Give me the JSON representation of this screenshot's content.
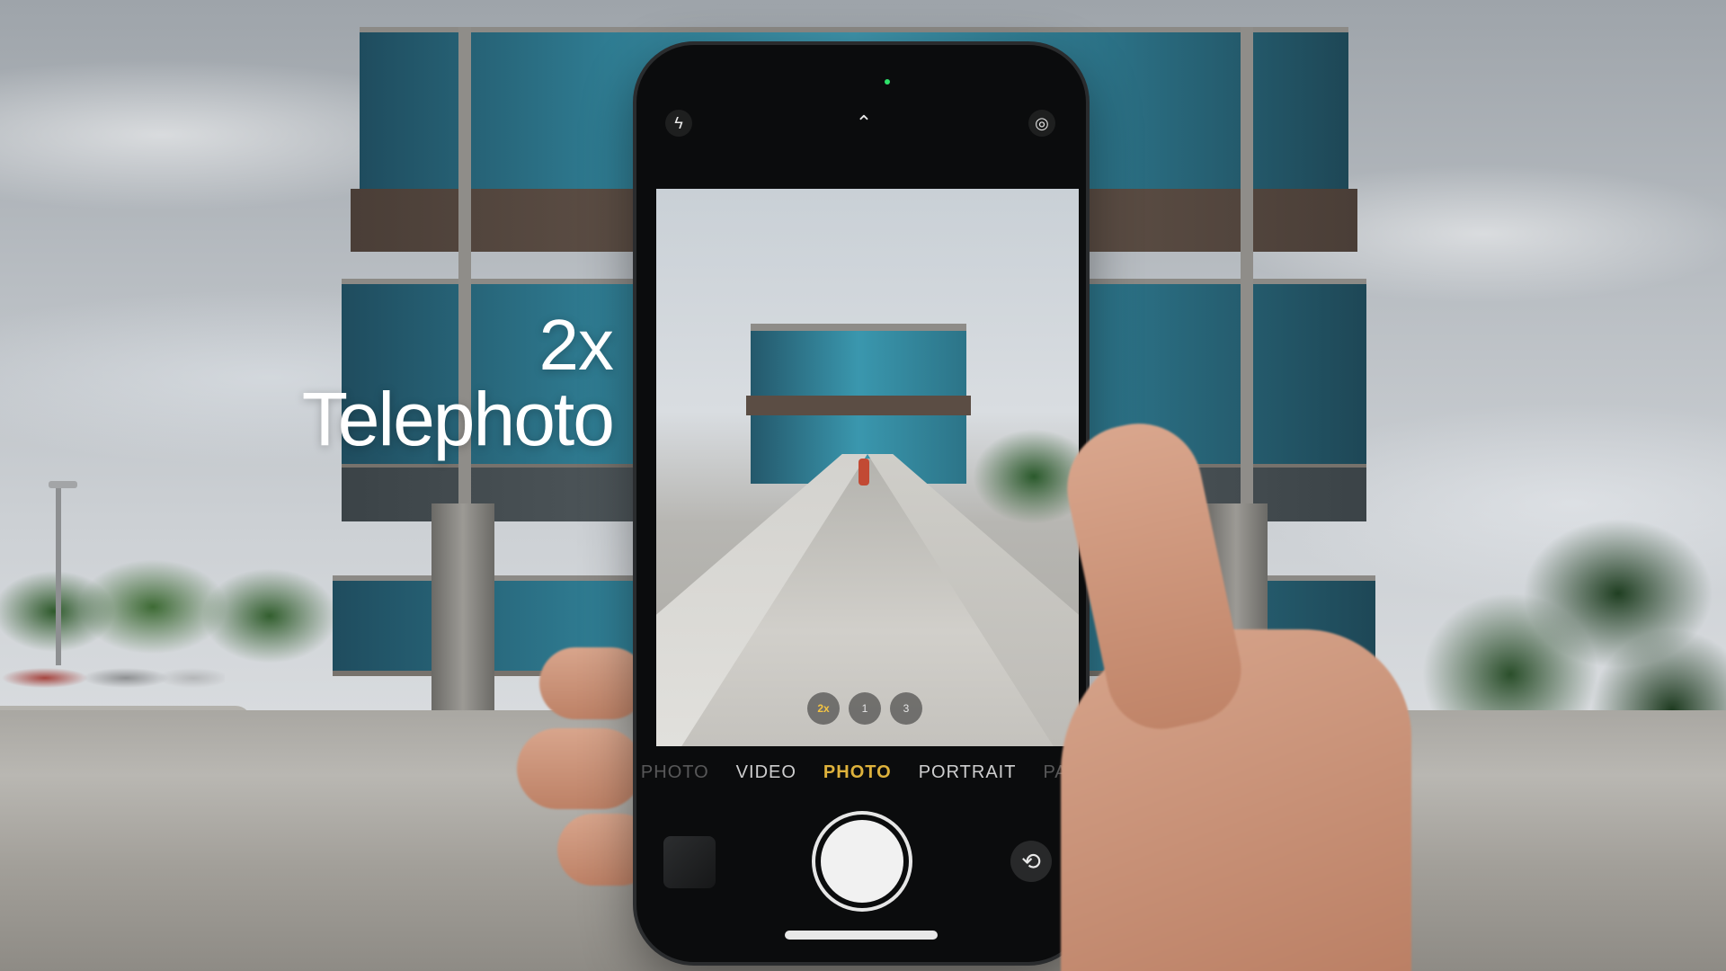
{
  "overlay": {
    "zoom_label": "2x",
    "lens_label": "Telephoto",
    "text_color": "#ffffff"
  },
  "camera": {
    "modes": [
      {
        "label": "PHOTO",
        "state": "faded"
      },
      {
        "label": "VIDEO",
        "state": "normal"
      },
      {
        "label": "PHOTO",
        "state": "active"
      },
      {
        "label": "PORTRAIT",
        "state": "normal"
      },
      {
        "label": "PAN",
        "state": "faded"
      }
    ],
    "zoom_options": [
      "2x",
      "1",
      "3"
    ],
    "accent_color": "#f5c542",
    "icons": {
      "flash": "flash-icon",
      "chevron": "chevron-up-icon",
      "live": "live-photo-icon",
      "flip": "camera-flip-icon"
    }
  }
}
